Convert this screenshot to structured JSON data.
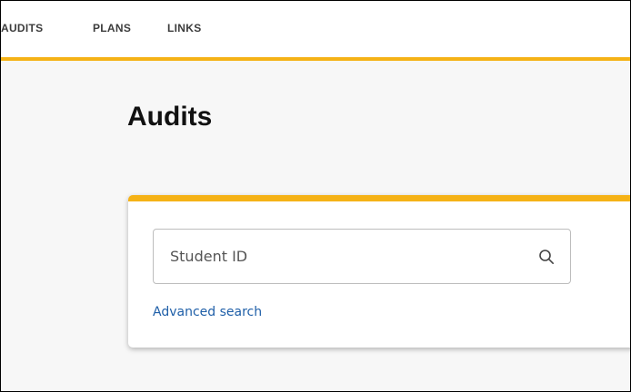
{
  "nav": {
    "items": [
      {
        "label": "AUDITS"
      },
      {
        "label": "PLANS"
      },
      {
        "label": "LINKS"
      }
    ]
  },
  "page": {
    "title": "Audits"
  },
  "search": {
    "placeholder": "Student ID",
    "value": "",
    "icon": "search-icon",
    "advanced_link": "Advanced search"
  },
  "colors": {
    "accent": "#f5b216",
    "link": "#1f5fa8",
    "background": "#f7f7f7"
  }
}
